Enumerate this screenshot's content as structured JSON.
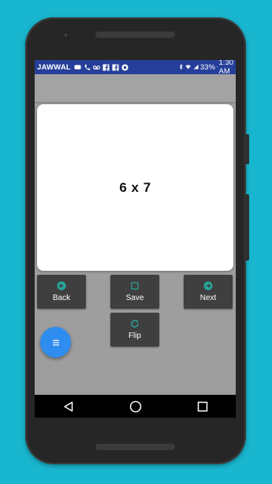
{
  "colors": {
    "background": "#19b6cf",
    "status_bar": "#263f9a",
    "button_bg": "#3f3f3f",
    "icon_teal": "#26a69a",
    "fab": "#2f8df0"
  },
  "status_bar": {
    "carrier": "JAWWAL",
    "battery": "33%",
    "time": "1:30 AM",
    "icons": [
      "message-icon",
      "call-icon",
      "voicemail-icon",
      "facebook-icon",
      "facebook-icon",
      "app-icon",
      "bluetooth-icon",
      "wifi-icon",
      "signal-icon",
      "battery-icon"
    ]
  },
  "card": {
    "text": "6 x 7"
  },
  "buttons": {
    "back": {
      "label": "Back",
      "icon": "arrow-left-circle-icon"
    },
    "save": {
      "label": "Save",
      "icon": "square-outline-icon"
    },
    "next": {
      "label": "Next",
      "icon": "arrow-right-circle-icon"
    },
    "flip": {
      "label": "Flip",
      "icon": "refresh-icon"
    }
  },
  "fab": {
    "icon": "menu-icon"
  },
  "nav_bar": {
    "buttons": [
      "back-triangle-icon",
      "home-circle-icon",
      "recents-square-icon"
    ]
  }
}
